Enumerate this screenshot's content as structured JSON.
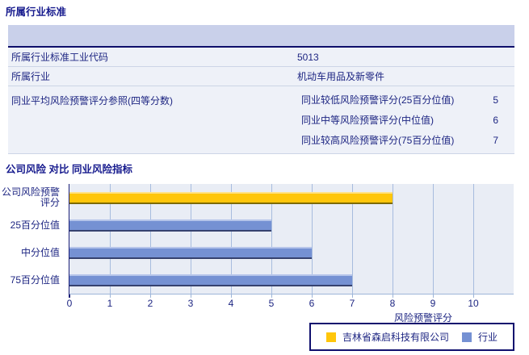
{
  "colors": {
    "text_navy": "#1d2582",
    "title_navy": "#171b8e",
    "header_band": "#c9d0ea",
    "row_bg": "#eef1f8",
    "border_navy": "#0e0e6a",
    "separator": "#ccd5e6",
    "plot_bg": "#e9edf5",
    "gridline": "#a7bcde",
    "company_bar": "#ffc60a",
    "industry_bar": "#7591d3"
  },
  "industry_table": {
    "title": "所属行业标准",
    "rows": [
      {
        "label": "所属行业标准工业代码",
        "value": "5013"
      },
      {
        "label": "所属行业",
        "value": "机动车用品及新零件"
      }
    ],
    "peer_group": {
      "label": "同业平均风险预警评分参照(四等分数)",
      "items": [
        {
          "label": "同业较低风险预警评分(25百分位值)",
          "value": "5"
        },
        {
          "label": "同业中等风险预警评分(中位值)",
          "value": "6"
        },
        {
          "label": "同业较高风险预警评分(75百分位值)",
          "value": "7"
        }
      ]
    }
  },
  "chart_section": {
    "title": "公司风险 对比 同业风险指标"
  },
  "chart_data": {
    "type": "bar",
    "orientation": "horizontal",
    "title": "公司风险 对比 同业风险指标",
    "categories": [
      "公司风险预警评分",
      "25百分位值",
      "中分位值",
      "75百分位值"
    ],
    "values": [
      8,
      5,
      6,
      7
    ],
    "series_key": [
      "company",
      "industry",
      "industry",
      "industry"
    ],
    "xlabel": "风险预警评分",
    "xlim": [
      0,
      11
    ],
    "xticks": [
      0,
      1,
      2,
      3,
      4,
      5,
      6,
      7,
      8,
      9,
      10
    ],
    "grid": true,
    "legend_position": "bottom-right",
    "legend": [
      {
        "label": "吉林省森启科技有限公司",
        "color_key": "company"
      },
      {
        "label": "行业",
        "color_key": "industry"
      }
    ]
  }
}
